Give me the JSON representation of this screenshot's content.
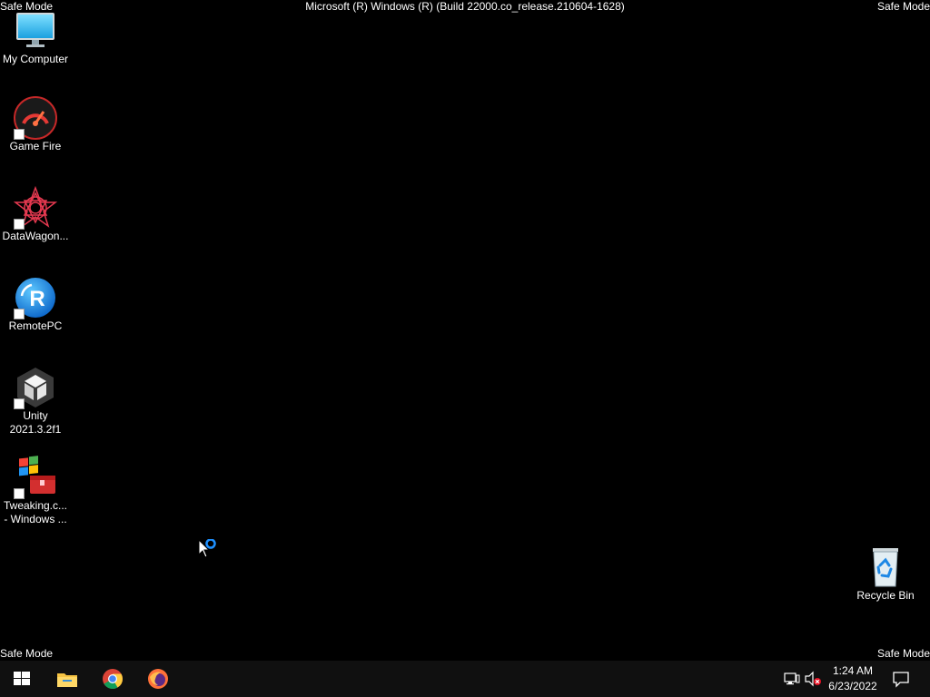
{
  "watermark": {
    "top_left": "Safe Mode",
    "top_right": "Safe Mode",
    "bottom_left": "Safe Mode",
    "bottom_right": "Safe Mode",
    "build": "Microsoft (R) Windows (R) (Build 22000.co_release.210604-1628)"
  },
  "desktop": {
    "icons": [
      {
        "label": "My Computer",
        "icon": "monitor-icon"
      },
      {
        "label": "Game Fire",
        "icon": "game-fire-icon",
        "shortcut": true
      },
      {
        "label": "DataWagon...",
        "icon": "datawagon-icon",
        "shortcut": true
      },
      {
        "label": "RemotePC",
        "icon": "remotepc-icon",
        "shortcut": true
      },
      {
        "label": "Unity",
        "label2": "2021.3.2f1",
        "icon": "unity-icon",
        "shortcut": true
      },
      {
        "label": "Tweaking.c...",
        "label2": "- Windows ...",
        "icon": "tweaking-icon",
        "shortcut": true
      },
      {
        "label": "Recycle Bin",
        "icon": "recycle-bin-icon"
      }
    ]
  },
  "taskbar": {
    "pinned": [
      "windows-start-icon",
      "file-explorer-icon",
      "chrome-icon",
      "firefox-icon"
    ],
    "tray": [
      "network-icon",
      "volume-muted-icon"
    ],
    "time": "1:24 AM",
    "date": "6/23/2022",
    "notification_icon": "action-center-icon"
  },
  "colors": {
    "background": "#000000",
    "taskbar": "#101010",
    "accent": "#0078d7"
  }
}
